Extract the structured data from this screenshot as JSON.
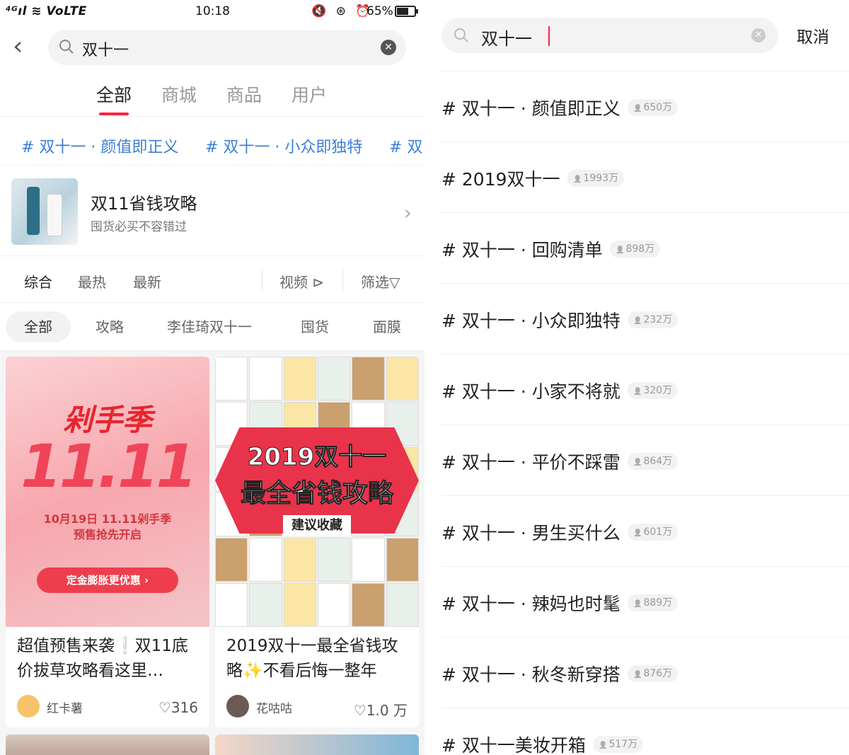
{
  "status_bar": {
    "network": "⁴ᴳıl ≋ VoLTE",
    "time": "10:18",
    "icons": "🔇 ⊛ ⏰",
    "battery_percent": "65%",
    "battery_level": 0.65
  },
  "left_search": {
    "query": "双十一"
  },
  "main_tabs": [
    {
      "label": "全部",
      "active": true
    },
    {
      "label": "商城",
      "active": false
    },
    {
      "label": "商品",
      "active": false
    },
    {
      "label": "用户",
      "active": false
    }
  ],
  "hashtags": [
    "# 双十一 · 颜值即正义",
    "# 双十一 · 小众即独特",
    "# 双"
  ],
  "guide_card": {
    "title": "双11省钱攻略",
    "subtitle": "囤货必买不容错过"
  },
  "sort": {
    "comprehensive": "综合",
    "hottest": "最热",
    "newest": "最新",
    "video": "视频",
    "filter": "筛选"
  },
  "filter_chips": [
    {
      "label": "全部",
      "active": true
    },
    {
      "label": "攻略",
      "active": false
    },
    {
      "label": "李佳琦双十一",
      "active": false
    },
    {
      "label": "囤货",
      "active": false
    },
    {
      "label": "面膜",
      "active": false
    }
  ],
  "feed": [
    {
      "image_headline": "剁手季",
      "image_big": "11.11",
      "image_line1": "10月19日 11.11剁手季",
      "image_line2": "预售抢先开启",
      "image_button": "定金膨胀更优惠 ›",
      "title": "超值预售来袭❕双11底价拔草攻略看这里…",
      "author": "红卡薯",
      "likes": "♡316"
    },
    {
      "image_line1": "2019双十一",
      "image_line2": "最全省钱攻略",
      "image_tag": "建议收藏",
      "title": "2019双十一最全省钱攻略✨不看后悔一整年",
      "author": "花咕咕",
      "likes": "♡1.0 万"
    }
  ],
  "right_search": {
    "query": "双十一",
    "cancel": "取消"
  },
  "suggestions": [
    {
      "text": "# 双十一 · 颜值即正义",
      "count": "650万"
    },
    {
      "text": "# 2019双十一",
      "count": "1993万"
    },
    {
      "text": "# 双十一 · 回购清单",
      "count": "898万"
    },
    {
      "text": "# 双十一 · 小众即独特",
      "count": "232万"
    },
    {
      "text": "# 双十一 · 小家不将就",
      "count": "320万"
    },
    {
      "text": "# 双十一 · 平价不踩雷",
      "count": "864万"
    },
    {
      "text": "# 双十一 · 男生买什么",
      "count": "601万"
    },
    {
      "text": "# 双十一 · 辣妈也时髦",
      "count": "889万"
    },
    {
      "text": "# 双十一 · 秋冬新穿搭",
      "count": "876万"
    },
    {
      "text": "# 双十一美妆开箱",
      "count": "517万"
    }
  ],
  "colors": {
    "accent": "#ff2442",
    "link": "#3d7fd6"
  }
}
